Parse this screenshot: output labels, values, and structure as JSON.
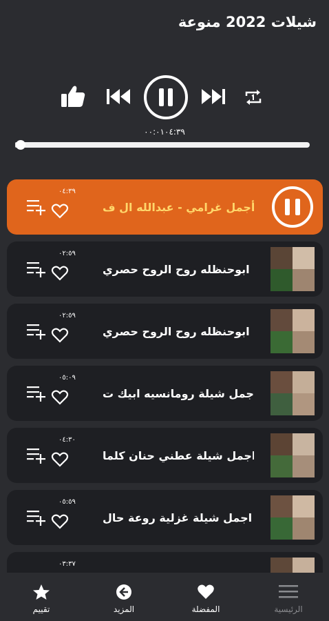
{
  "app": {
    "title": "شيلات 2022 منوعة"
  },
  "player": {
    "time_readout": "٠٠:٠١٠٤:٣٩",
    "progress_fraction": 0.01
  },
  "tracks": [
    {
      "title": "أجمل غرامي - عبدالله ال ف",
      "duration": "٠٤:٣٩",
      "active": true
    },
    {
      "title": "ابوحنظله  روح الروح  حصري",
      "duration": "٠٢:٥٩",
      "active": false
    },
    {
      "title": "ابوحنظله  روح الروح  حصري",
      "duration": "٠٢:٥٩",
      "active": false
    },
    {
      "title": "اجمل شيلة رومانسيه ابيك ت",
      "duration": "٠٥:٠٩",
      "active": false
    },
    {
      "title": "اجمل شيلة عطني حنان  كلما",
      "duration": "٠٤:٣٠",
      "active": false
    },
    {
      "title": "اجمل شيلة غزلية روعة  حال",
      "duration": "٠٥:٥٩",
      "active": false
    },
    {
      "title": "",
      "duration": "٠٣:٣٧",
      "active": false
    }
  ],
  "nav": {
    "home": "الرئيسية",
    "favorites": "المفضلة",
    "more": "المزيد",
    "rate": "تقييم"
  },
  "colors": {
    "background": "#2b2c30",
    "card": "#1e1f23",
    "accent": "#e0651c",
    "active_title": "#ffd76b"
  }
}
